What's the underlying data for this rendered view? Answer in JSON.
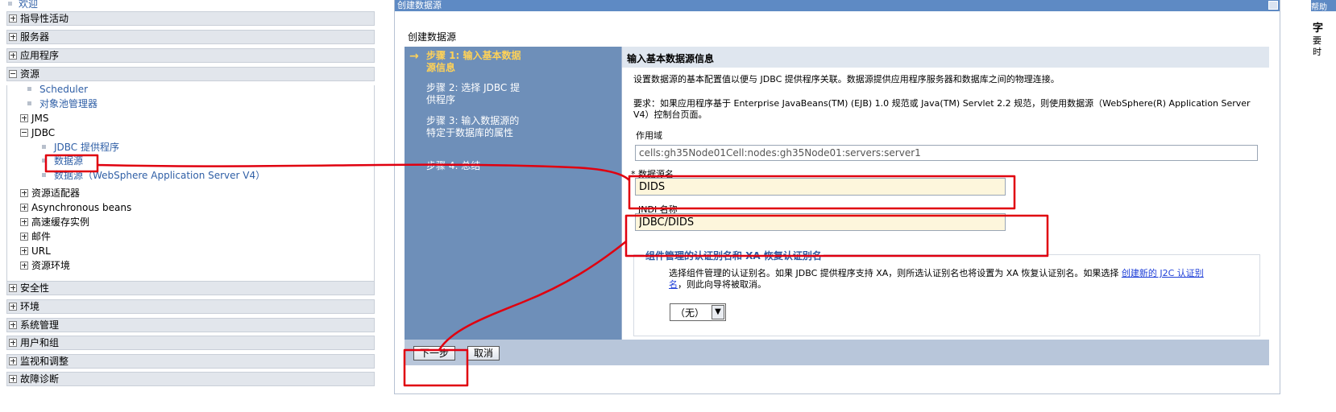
{
  "nav": {
    "welcome": "欢迎",
    "categories": [
      {
        "label": "指导性活动"
      },
      {
        "label": "服务器"
      },
      {
        "label": "应用程序"
      },
      {
        "label": "资源"
      },
      {
        "label": "安全性"
      },
      {
        "label": "环境"
      },
      {
        "label": "系统管理"
      },
      {
        "label": "用户和组"
      },
      {
        "label": "监视和调整"
      },
      {
        "label": "故障诊断"
      }
    ],
    "resources": {
      "scheduler": "Scheduler",
      "object_pool": "对象池管理器",
      "jms": "JMS",
      "jdbc": "JDBC",
      "jdbc_provider": "JDBC 提供程序",
      "datasource": "数据源",
      "datasource_v4": "数据源（WebSphere Application Server V4）",
      "adapters": "资源适配器",
      "async_beans": "Asynchronous beans",
      "cache": "高速缓存实例",
      "mail": "邮件",
      "url": "URL",
      "env": "资源环境"
    }
  },
  "main": {
    "window_title": "创建数据源",
    "breadcrumb": "创建数据源",
    "steps": [
      {
        "label": "步骤 1: 输入基本数据源信息"
      },
      {
        "label": "步骤 2: 选择 JDBC 提供程序"
      },
      {
        "label": "步骤 3: 输入数据源的特定于数据库的属性"
      },
      {
        "label": "步骤 4: 总结"
      }
    ],
    "arrow": "→",
    "content_title": "输入基本数据源信息",
    "desc1": "设置数据源的基本配置值以便与 JDBC 提供程序关联。数据源提供应用程序服务器和数据库之间的物理连接。",
    "desc2": "要求：如果应用程序基于 Enterprise JavaBeans(TM) (EJB) 1.0 规范或 Java(TM) Servlet 2.2 规范，则使用数据源（WebSphere(R) Application Server V4）控制台页面。",
    "scope_label": "作用域",
    "scope_value": "cells:gh35Node01Cell:nodes:gh35Node01:servers:server1",
    "ds_name_label": "* 数据源名",
    "ds_name_value": "DIDS",
    "jndi_label": "JNDI 名称",
    "jndi_value": "JDBC/DIDS",
    "auth_legend": "组件管理的认证别名和 XA 恢复认证别名",
    "auth_text_before": "选择组件管理的认证别名。如果 JDBC 提供程序支持 XA，则所选认证别名也将设置为 XA 恢复认证别名。如果选择 ",
    "auth_link": "创建新的 J2C 认证别名",
    "auth_text_after": "，则此向导将被取消。",
    "alias_selected": "（无）",
    "next_button": "下一步",
    "cancel_button": "取消"
  },
  "help": {
    "bar": "帮助",
    "t1": "字",
    "t2": "要时"
  },
  "colors": {
    "annotation": "#e0000f",
    "steps_bg": "#6e8fb9",
    "active_step": "#ffd257",
    "input_bg": "#fdf6dc"
  }
}
